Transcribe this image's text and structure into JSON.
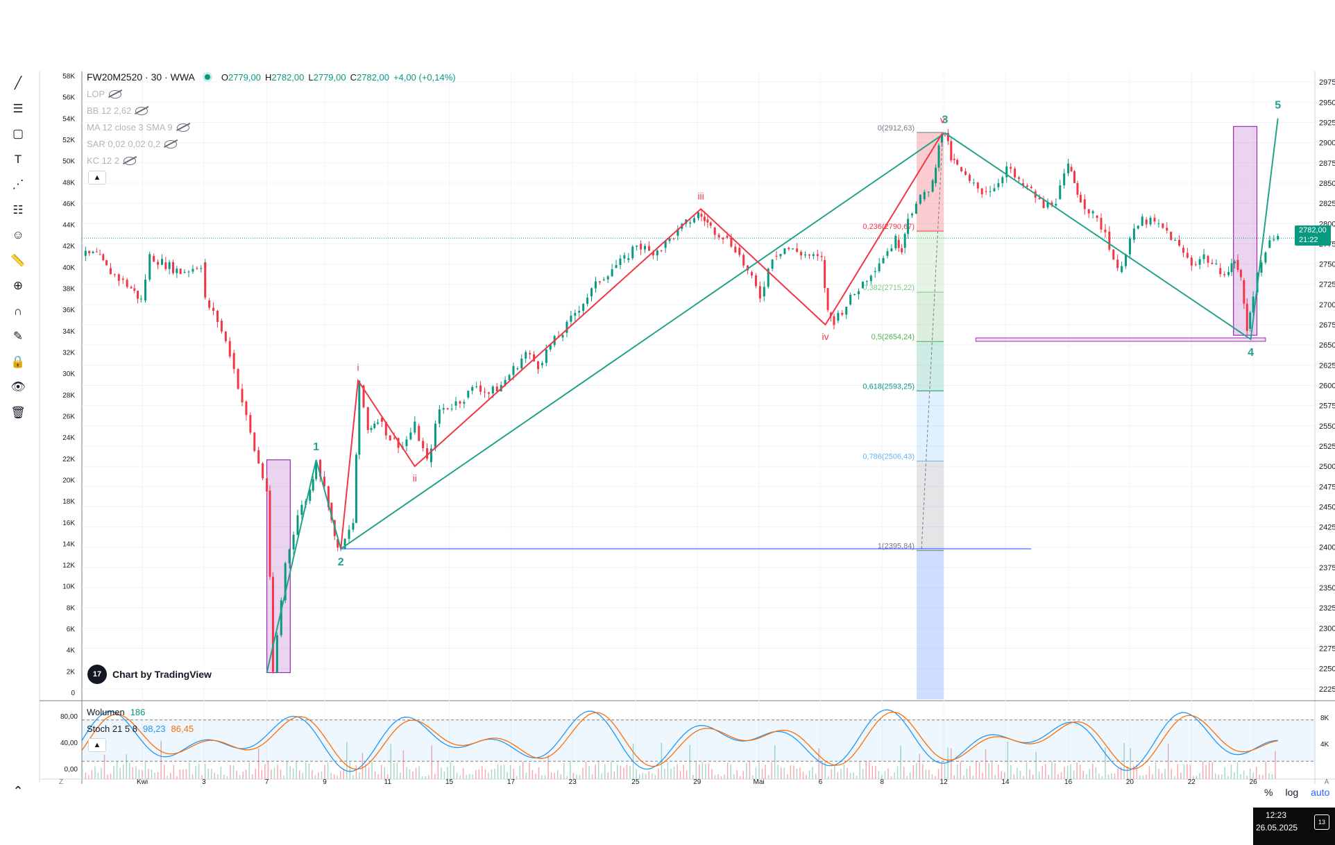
{
  "chart_data": {
    "type": "candlestick",
    "symbol_title": "FW20M2520 · 30 · WWA",
    "ohlc": {
      "o_label": "O",
      "o": "2779,00",
      "h_label": "H",
      "h": "2782,00",
      "l_label": "L",
      "l": "2779,00",
      "c_label": "C",
      "c": "2782,00",
      "change": "+4,00 (+0,14%)"
    },
    "indicators": [
      "LOP",
      "BB 12 2,62",
      "MA 12 close 3 SMA 9",
      "SAR 0,02 0,02 0,2",
      "KC 12 2"
    ],
    "price_axis": {
      "min": 2212,
      "max": 2988,
      "ticks": [
        "2975,00",
        "2950,00",
        "2925,00",
        "2900,00",
        "2875,00",
        "2850,00",
        "2825,00",
        "2800,00",
        "2775,00",
        "2750,00",
        "2725,00",
        "2700,00",
        "2675,00",
        "2650,00",
        "2625,00",
        "2600,00",
        "2575,00",
        "2550,00",
        "2525,00",
        "2500,00",
        "2475,00",
        "2450,00",
        "2425,00",
        "2400,00",
        "2375,00",
        "2350,00",
        "2325,00",
        "2300,00",
        "2275,00",
        "2250,00",
        "2225,00"
      ]
    },
    "volume_axis": {
      "ticks": [
        "58K",
        "56K",
        "54K",
        "52K",
        "50K",
        "48K",
        "46K",
        "44K",
        "42K",
        "40K",
        "38K",
        "36K",
        "34K",
        "32K",
        "30K",
        "28K",
        "26K",
        "24K",
        "22K",
        "20K",
        "18K",
        "16K",
        "14K",
        "12K",
        "10K",
        "8K",
        "6K",
        "4K",
        "2K",
        "0"
      ]
    },
    "time_axis": {
      "labels": [
        "Kwi",
        "3",
        "7",
        "9",
        "11",
        "15",
        "17",
        "23",
        "25",
        "29",
        "Maj",
        "6",
        "8",
        "12",
        "14",
        "16",
        "20",
        "22",
        "26"
      ],
      "positions": [
        0.049,
        0.099,
        0.15,
        0.197,
        0.248,
        0.298,
        0.348,
        0.398,
        0.449,
        0.499,
        0.549,
        0.599,
        0.649,
        0.699,
        0.749,
        0.8,
        0.85,
        0.9,
        0.95
      ]
    },
    "last_price": {
      "value": "2782,00",
      "countdown": "21:22",
      "price": 2782
    },
    "price_path": [
      [
        0.0,
        2760
      ],
      [
        0.012,
        2762
      ],
      [
        0.02,
        2745
      ],
      [
        0.03,
        2732
      ],
      [
        0.04,
        2720
      ],
      [
        0.048,
        2705
      ],
      [
        0.055,
        2760
      ],
      [
        0.065,
        2752
      ],
      [
        0.08,
        2740
      ],
      [
        0.09,
        2745
      ],
      [
        0.1,
        2752
      ],
      [
        0.1,
        2705
      ],
      [
        0.11,
        2680
      ],
      [
        0.12,
        2640
      ],
      [
        0.13,
        2580
      ],
      [
        0.14,
        2520
      ],
      [
        0.15,
        2470
      ],
      [
        0.155,
        2245
      ],
      [
        0.165,
        2380
      ],
      [
        0.175,
        2440
      ],
      [
        0.185,
        2470
      ],
      [
        0.19,
        2508
      ],
      [
        0.2,
        2455
      ],
      [
        0.205,
        2410
      ],
      [
        0.21,
        2398
      ],
      [
        0.22,
        2430
      ],
      [
        0.225,
        2600
      ],
      [
        0.232,
        2545
      ],
      [
        0.24,
        2560
      ],
      [
        0.25,
        2535
      ],
      [
        0.26,
        2525
      ],
      [
        0.27,
        2550
      ],
      [
        0.28,
        2505
      ],
      [
        0.29,
        2570
      ],
      [
        0.3,
        2575
      ],
      [
        0.31,
        2585
      ],
      [
        0.32,
        2600
      ],
      [
        0.33,
        2590
      ],
      [
        0.34,
        2600
      ],
      [
        0.35,
        2620
      ],
      [
        0.36,
        2640
      ],
      [
        0.37,
        2625
      ],
      [
        0.38,
        2650
      ],
      [
        0.39,
        2665
      ],
      [
        0.4,
        2690
      ],
      [
        0.41,
        2710
      ],
      [
        0.42,
        2730
      ],
      [
        0.43,
        2745
      ],
      [
        0.44,
        2755
      ],
      [
        0.45,
        2775
      ],
      [
        0.46,
        2765
      ],
      [
        0.47,
        2770
      ],
      [
        0.48,
        2785
      ],
      [
        0.49,
        2800
      ],
      [
        0.5,
        2812
      ],
      [
        0.505,
        2805
      ],
      [
        0.51,
        2795
      ],
      [
        0.52,
        2785
      ],
      [
        0.53,
        2770
      ],
      [
        0.54,
        2740
      ],
      [
        0.55,
        2710
      ],
      [
        0.56,
        2760
      ],
      [
        0.57,
        2770
      ],
      [
        0.58,
        2765
      ],
      [
        0.59,
        2760
      ],
      [
        0.6,
        2755
      ],
      [
        0.605,
        2690
      ],
      [
        0.61,
        2680
      ],
      [
        0.62,
        2700
      ],
      [
        0.63,
        2720
      ],
      [
        0.64,
        2740
      ],
      [
        0.65,
        2760
      ],
      [
        0.66,
        2780
      ],
      [
        0.665,
        2770
      ],
      [
        0.67,
        2810
      ],
      [
        0.68,
        2830
      ],
      [
        0.69,
        2850
      ],
      [
        0.695,
        2900
      ],
      [
        0.7,
        2912
      ],
      [
        0.705,
        2880
      ],
      [
        0.71,
        2870
      ],
      [
        0.72,
        2850
      ],
      [
        0.73,
        2840
      ],
      [
        0.74,
        2845
      ],
      [
        0.75,
        2870
      ],
      [
        0.76,
        2850
      ],
      [
        0.77,
        2840
      ],
      [
        0.78,
        2820
      ],
      [
        0.79,
        2830
      ],
      [
        0.8,
        2870
      ],
      [
        0.805,
        2850
      ],
      [
        0.81,
        2830
      ],
      [
        0.82,
        2810
      ],
      [
        0.83,
        2790
      ],
      [
        0.84,
        2740
      ],
      [
        0.85,
        2780
      ],
      [
        0.86,
        2805
      ],
      [
        0.87,
        2800
      ],
      [
        0.88,
        2790
      ],
      [
        0.89,
        2770
      ],
      [
        0.9,
        2750
      ],
      [
        0.91,
        2760
      ],
      [
        0.92,
        2745
      ],
      [
        0.93,
        2740
      ],
      [
        0.935,
        2755
      ],
      [
        0.94,
        2730
      ],
      [
        0.945,
        2670
      ],
      [
        0.95,
        2715
      ],
      [
        0.96,
        2770
      ],
      [
        0.97,
        2782
      ]
    ],
    "wave_labels_green": [
      {
        "text": "1",
        "t": 0.19,
        "p": 2508
      },
      {
        "text": "2",
        "t": 0.21,
        "p": 2398
      },
      {
        "text": "3",
        "t": 0.7,
        "p": 2912
      },
      {
        "text": "4",
        "t": 0.948,
        "p": 2657
      },
      {
        "text": "5",
        "t": 0.97,
        "p": 2930
      }
    ],
    "wave_labels_red": [
      {
        "text": "i",
        "t": 0.224,
        "p": 2606
      },
      {
        "text": "ii",
        "t": 0.27,
        "p": 2500
      },
      {
        "text": "iii",
        "t": 0.502,
        "p": 2818
      },
      {
        "text": "iv",
        "t": 0.603,
        "p": 2675
      },
      {
        "text": "v",
        "t": 0.698,
        "p": 2912
      }
    ],
    "green_wave": [
      [
        0.15,
        2245
      ],
      [
        0.19,
        2508
      ],
      [
        0.21,
        2398
      ],
      [
        0.7,
        2912
      ],
      [
        0.948,
        2657
      ],
      [
        0.97,
        2930
      ]
    ],
    "red_wave": [
      [
        0.21,
        2398
      ],
      [
        0.224,
        2606
      ],
      [
        0.27,
        2500
      ],
      [
        0.502,
        2818
      ],
      [
        0.603,
        2675
      ],
      [
        0.698,
        2912
      ]
    ],
    "fib_levels": [
      {
        "label": "0(2912,63)",
        "price": 2912.63,
        "color": "#787b86"
      },
      {
        "label": "0,236(2790,67)",
        "price": 2790.67,
        "color": "#f23645"
      },
      {
        "label": "0,382(2715,22)",
        "price": 2715.22,
        "color": "#81c784"
      },
      {
        "label": "0,5(2654,24)",
        "price": 2654.24,
        "color": "#4caf50"
      },
      {
        "label": "0,618(2593,25)",
        "price": 2593.25,
        "color": "#089981"
      },
      {
        "label": "0,786(2506,43)",
        "price": 2506.43,
        "color": "#64b5f6"
      },
      {
        "label": "1(2395,84)",
        "price": 2395.84,
        "color": "#787b86"
      }
    ],
    "support_line": {
      "price": 2398,
      "t_start": 0.21,
      "t_end": 0.77
    },
    "zone_line": {
      "price": 2657,
      "t_start": 0.725,
      "t_end": 0.96
    },
    "purple_boxes": [
      {
        "t_start": 0.15,
        "t_end": 0.169,
        "p_low": 2245,
        "p_high": 2508
      },
      {
        "t_start": 0.934,
        "t_end": 0.953,
        "p_low": 2662,
        "p_high": 2920
      }
    ]
  },
  "sub_panel": {
    "volume_label": "Wolumen",
    "volume_value": "186",
    "stoch_label": "Stoch 21 5 8",
    "stoch_k": "98,23",
    "stoch_d": "86,45",
    "left_ticks": [
      "80,00",
      "40,00",
      "0,00"
    ],
    "right_ticks": [
      "8K",
      "4K"
    ]
  },
  "badge": {
    "text": "Chart by TradingView",
    "logo": "17"
  },
  "axis_corner": {
    "left": "Z",
    "right": "A"
  },
  "bottom_controls": {
    "percent": "%",
    "log": "log",
    "auto": "auto"
  },
  "taskbar": {
    "time": "12:23",
    "date": "26.05.2025",
    "notifications": "13"
  },
  "colors": {
    "up": "#089981",
    "down": "#f23645",
    "green_wave": "#22a28a",
    "red_wave": "#f23645",
    "purple": "#9c27b0",
    "blue": "#2962ff"
  },
  "tools": [
    "trend-line-icon",
    "fib-icon",
    "rectangle-icon",
    "text-icon",
    "pattern-icon",
    "forecast-icon",
    "emoji-icon",
    "ruler-icon",
    "zoom-icon",
    "magnet-icon",
    "lock-draw-icon",
    "lock-icon",
    "eye-icon",
    "trash-icon"
  ]
}
